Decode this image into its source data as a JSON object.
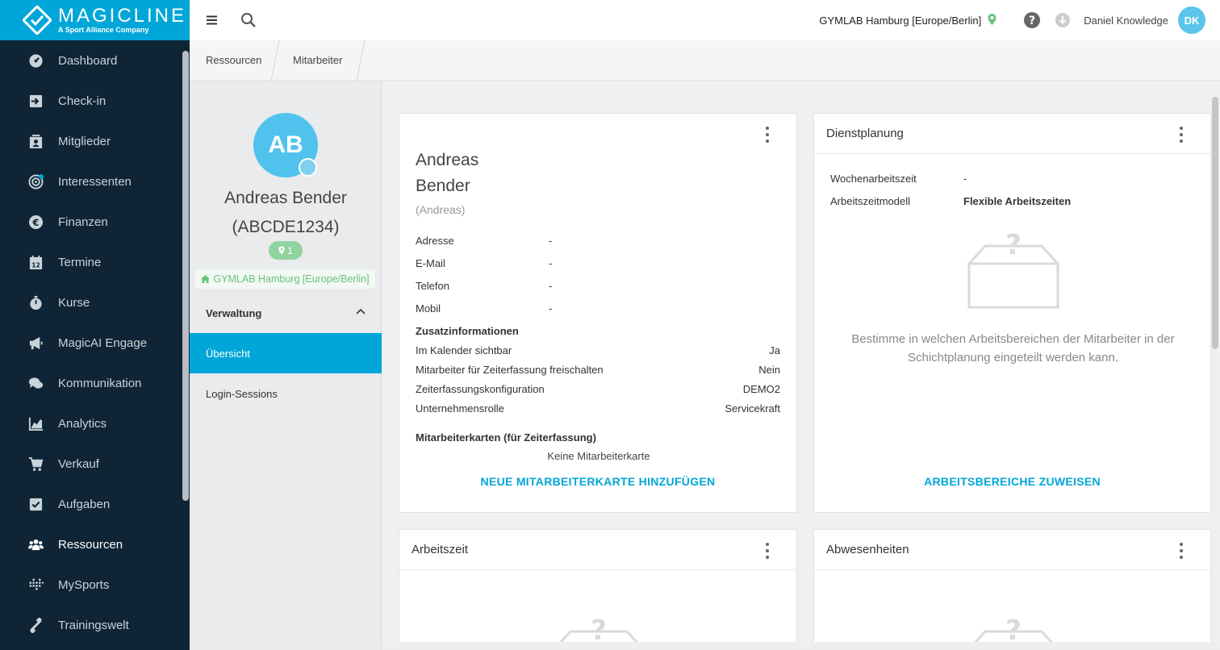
{
  "app": {
    "brand": "MAGICLINE",
    "tagline": "A Sport Alliance Company"
  },
  "sidebar": {
    "items": [
      {
        "label": "Dashboard",
        "icon": "dashboard-icon"
      },
      {
        "label": "Check-in",
        "icon": "check-in-icon"
      },
      {
        "label": "Mitglieder",
        "icon": "members-icon"
      },
      {
        "label": "Interessenten",
        "icon": "prospects-icon"
      },
      {
        "label": "Finanzen",
        "icon": "euro-icon"
      },
      {
        "label": "Termine",
        "icon": "calendar-icon"
      },
      {
        "label": "Kurse",
        "icon": "stopwatch-icon"
      },
      {
        "label": "MagicAI Engage",
        "icon": "megaphone-icon"
      },
      {
        "label": "Kommunikation",
        "icon": "chat-icon"
      },
      {
        "label": "Analytics",
        "icon": "chart-icon"
      },
      {
        "label": "Verkauf",
        "icon": "cart-icon"
      },
      {
        "label": "Aufgaben",
        "icon": "task-check-icon"
      },
      {
        "label": "Ressourcen",
        "icon": "people-icon"
      },
      {
        "label": "MySports",
        "icon": "dots-grid-icon"
      },
      {
        "label": "Trainingswelt",
        "icon": "dumbbell-icon"
      }
    ],
    "active": "Ressourcen"
  },
  "topbar": {
    "studio": "GYMLAB Hamburg [Europe/Berlin]",
    "user_name": "Daniel Knowledge",
    "user_initials": "DK"
  },
  "breadcrumb": [
    "Ressourcen",
    "Mitarbeiter"
  ],
  "profile": {
    "initials": "AB",
    "name": "Andreas Bender",
    "id": "(ABCDE1234)",
    "badge_count": "1",
    "studio": "GYMLAB Hamburg [Europe/Berlin]",
    "section": "Verwaltung",
    "tabs": [
      "Übersicht",
      "Login-Sessions"
    ],
    "active_tab": "Übersicht"
  },
  "employee": {
    "first_name": "Andreas",
    "last_name": "Bender",
    "nickname": "(Andreas)",
    "contact": [
      {
        "label": "Adresse",
        "value": "-"
      },
      {
        "label": "E-Mail",
        "value": "-"
      },
      {
        "label": "Telefon",
        "value": "-"
      },
      {
        "label": "Mobil",
        "value": "-"
      }
    ],
    "extra_title": "Zusatzinformationen",
    "extra": [
      {
        "label": "Im Kalender sichtbar",
        "value": "Ja"
      },
      {
        "label": "Mitarbeiter für Zeiterfassung freischalten",
        "value": "Nein"
      },
      {
        "label": "Zeiterfassungskonfiguration",
        "value": "DEMO2"
      },
      {
        "label": "Unternehmensrolle",
        "value": "Servicekraft"
      }
    ],
    "cards_title": "Mitarbeiterkarten (für Zeiterfassung)",
    "no_cards": "Keine Mitarbeiterkarte",
    "add_card": "NEUE MITARBEITERKARTE HINZUFÜGEN"
  },
  "dienstplanung": {
    "title": "Dienstplanung",
    "rows": [
      {
        "label": "Wochenarbeitszeit",
        "value": "-"
      },
      {
        "label": "Arbeitszeitmodell",
        "value": "Flexible Arbeitszeiten"
      }
    ],
    "empty_text": "Bestimme in welchen Arbeitsbereichen der Mitarbeiter in der Schichtplanung eingeteilt werden kann.",
    "action": "ARBEITSBEREICHE ZUWEISEN"
  },
  "arbeitszeit": {
    "title": "Arbeitszeit"
  },
  "abwesenheiten": {
    "title": "Abwesenheiten"
  },
  "colors": {
    "sidebar_bg": "#0f2535",
    "accent": "#00a6d8",
    "badge_green": "#8fd39e",
    "studio_green": "#6bc27c"
  }
}
